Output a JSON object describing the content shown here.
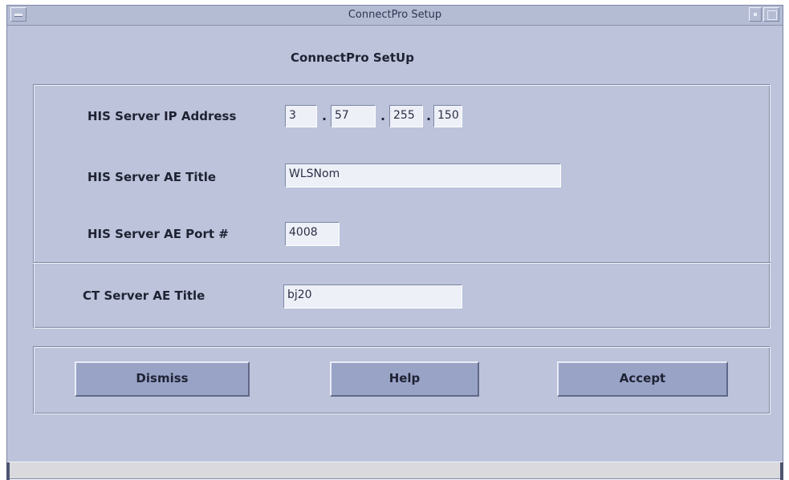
{
  "window": {
    "title": "ConnectPro Setup"
  },
  "dialog": {
    "heading": "ConnectPro SetUp"
  },
  "fields": {
    "ip_label": "HIS Server IP Address",
    "ip_octets": [
      "3",
      "57",
      "255",
      "150"
    ],
    "ip_separator": ".",
    "ae_title_label": "HIS Server AE Title",
    "ae_title_value": "WLSNom",
    "ae_port_label": "HIS Server AE Port #",
    "ae_port_value": "4008",
    "ct_title_label": "CT Server AE Title",
    "ct_title_value": "bj20"
  },
  "buttons": {
    "dismiss": "Dismiss",
    "help": "Help",
    "accept": "Accept"
  },
  "colors": {
    "window_bg": "#bcc3da",
    "button_bg": "#98a3c6",
    "field_bg": "#eef0f8"
  },
  "icons": {
    "window_menu": "window-menu-icon",
    "minimize": "minimize-icon",
    "maximize": "maximize-icon"
  }
}
